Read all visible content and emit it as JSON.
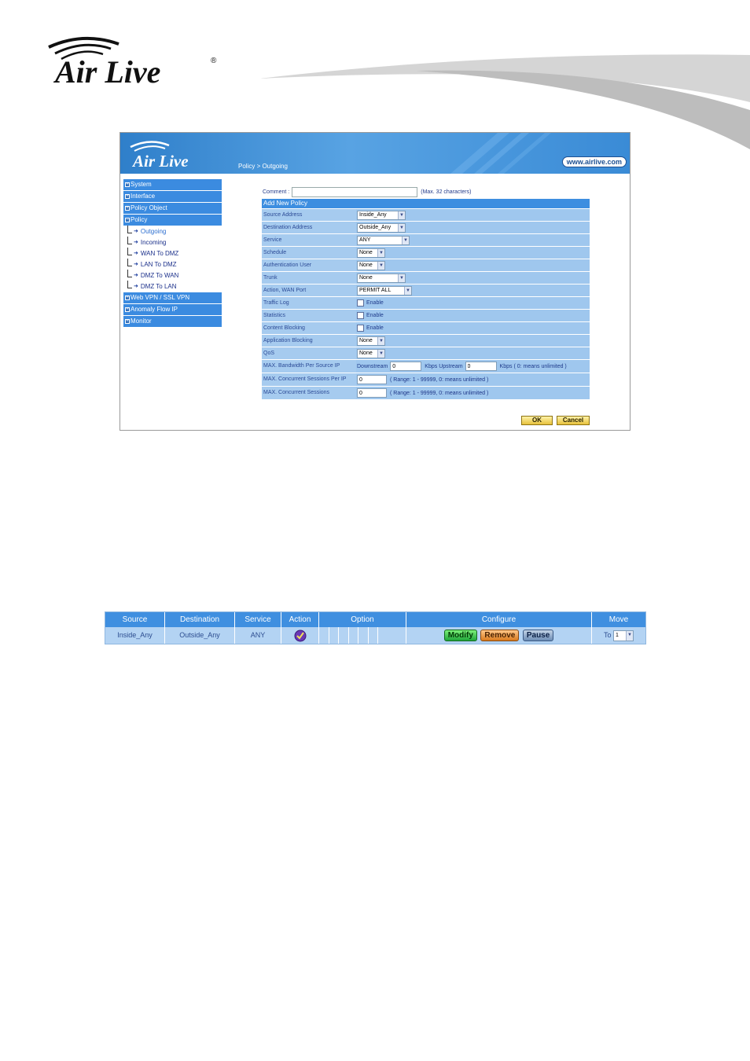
{
  "brand": {
    "name": "Air Live",
    "registered": "®"
  },
  "screenshot1": {
    "banner": {
      "breadcrumb": "Policy > Outgoing",
      "url": "www.airlive.com"
    },
    "sidebar": {
      "top_items": [
        {
          "label": "System",
          "marker": "+"
        },
        {
          "label": "Interface",
          "marker": "+"
        },
        {
          "label": "Policy Object",
          "marker": "+"
        },
        {
          "label": "Policy",
          "marker": "−"
        }
      ],
      "sub_items": [
        "Outgoing",
        "Incoming",
        "WAN To DMZ",
        "LAN To DMZ",
        "DMZ To WAN",
        "DMZ To LAN"
      ],
      "bottom_items": [
        {
          "label": "Web VPN / SSL VPN",
          "marker": "+"
        },
        {
          "label": "Anomaly Flow IP",
          "marker": "+"
        },
        {
          "label": "Monitor",
          "marker": "+"
        }
      ]
    },
    "comment": {
      "label": "Comment :",
      "value": "",
      "hint": "(Max. 32 characters)"
    },
    "table_title": "Add New Policy",
    "fields": {
      "source_address": {
        "label": "Source Address",
        "value": "Inside_Any"
      },
      "destination_address": {
        "label": "Destination Address",
        "value": "Outside_Any"
      },
      "service": {
        "label": "Service",
        "value": "ANY"
      },
      "schedule": {
        "label": "Schedule",
        "value": "None"
      },
      "authentication_user": {
        "label": "Authentication User",
        "value": "None"
      },
      "trunk": {
        "label": "Trunk",
        "value": "None"
      },
      "action_wan_port": {
        "label": "Action, WAN Port",
        "value": "PERMIT ALL"
      },
      "traffic_log": {
        "label": "Traffic Log",
        "option": "Enable"
      },
      "statistics": {
        "label": "Statistics",
        "option": "Enable"
      },
      "content_blocking": {
        "label": "Content Blocking",
        "option": "Enable"
      },
      "application_blocking": {
        "label": "Application Blocking",
        "value": "None"
      },
      "qos": {
        "label": "QoS",
        "value": "None"
      },
      "max_bandwidth": {
        "label": "MAX. Bandwidth Per Source IP",
        "downstream_label": "Downstream",
        "downstream_value": "0",
        "upstream_label": "Kbps Upstream",
        "upstream_value": "0",
        "unit_hint": "Kbps ( 0: means unlimited )"
      },
      "max_sessions_per_ip": {
        "label": "MAX. Concurrent Sessions Per IP",
        "value": "0",
        "hint": "( Range: 1 - 99999, 0: means unlimited )"
      },
      "max_sessions": {
        "label": "MAX. Concurrent Sessions",
        "value": "0",
        "hint": "( Range: 1 - 99999, 0: means unlimited )"
      }
    },
    "buttons": {
      "ok": "OK",
      "cancel": "Cancel"
    }
  },
  "screenshot2": {
    "headers": [
      "Source",
      "Destination",
      "Service",
      "Action",
      "Option",
      "Configure",
      "Move"
    ],
    "row": {
      "source": "Inside_Any",
      "destination": "Outside_Any",
      "service": "ANY",
      "action_icon": "permit-check-icon",
      "modify": "Modify",
      "remove": "Remove",
      "pause": "Pause",
      "move_label": "To",
      "move_value": "1"
    }
  },
  "colors": {
    "accent": "#3d8ee0",
    "row_bg": "#a9cdf0",
    "link": "#1a2f8a"
  }
}
